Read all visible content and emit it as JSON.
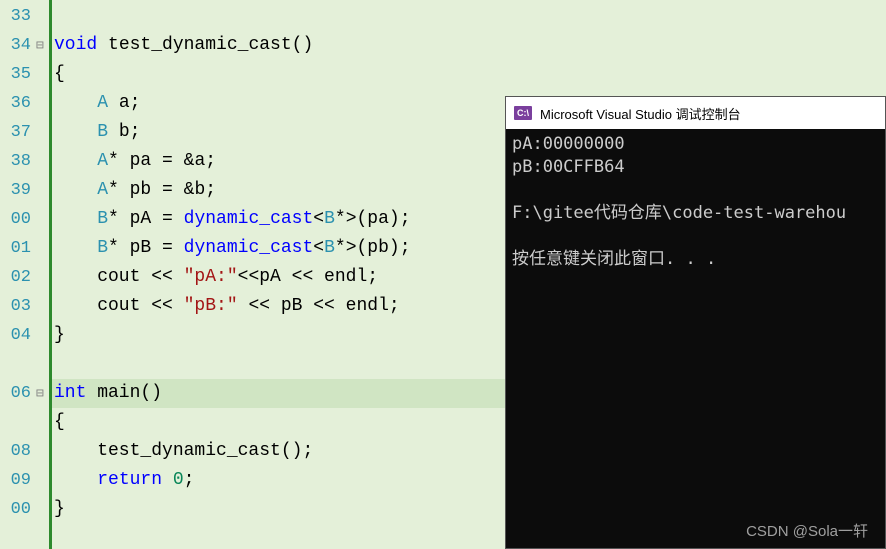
{
  "editor": {
    "lines": [
      {
        "num": "33",
        "fold": "",
        "html": ""
      },
      {
        "num": "34",
        "fold": "⊟",
        "html": "<span class='kw'>void</span> test_dynamic_cast()"
      },
      {
        "num": "35",
        "fold": "",
        "html": "{"
      },
      {
        "num": "36",
        "fold": "",
        "html": "    <span class='typ'>A</span> a;"
      },
      {
        "num": "37",
        "fold": "",
        "html": "    <span class='typ'>B</span> b;"
      },
      {
        "num": "38",
        "fold": "",
        "html": "    <span class='typ'>A</span>* pa = &amp;a;"
      },
      {
        "num": "39",
        "fold": "",
        "html": "    <span class='typ'>A</span>* pb = &amp;b;"
      },
      {
        "num": "00",
        "fold": "",
        "html": "    <span class='typ'>B</span>* pA = <span class='kw'>dynamic_cast</span>&lt;<span class='typ'>B</span>*&gt;(pa);"
      },
      {
        "num": "01",
        "fold": "",
        "html": "    <span class='typ'>B</span>* pB = <span class='kw'>dynamic_cast</span>&lt;<span class='typ'>B</span>*&gt;(pb);"
      },
      {
        "num": "02",
        "fold": "",
        "html": "    cout &lt;&lt; <span class='str'>\"pA:\"</span>&lt;&lt;pA &lt;&lt; endl;"
      },
      {
        "num": "03",
        "fold": "",
        "html": "    cout &lt;&lt; <span class='str'>\"pB:\"</span> &lt;&lt; pB &lt;&lt; endl;"
      },
      {
        "num": "04",
        "fold": "",
        "html": "}"
      },
      {
        "num": "",
        "fold": "",
        "html": ""
      },
      {
        "num": "06",
        "fold": "⊟",
        "html": "<span class='kw'>int</span> main()",
        "hl": true
      },
      {
        "num": "",
        "fold": "",
        "html": "{"
      },
      {
        "num": "08",
        "fold": "",
        "html": "    test_dynamic_cast();"
      },
      {
        "num": "09",
        "fold": "",
        "html": "    <span class='kw'>return</span> <span class='num'>0</span>;"
      },
      {
        "num": "00",
        "fold": "",
        "html": "}"
      }
    ]
  },
  "console": {
    "icon_text": "C:\\",
    "title": "Microsoft Visual Studio 调试控制台",
    "output": "pA:00000000\npB:00CFFB64\n\nF:\\gitee代码仓库\\code-test-warehou\n\n按任意键关闭此窗口. . ."
  },
  "watermark": "CSDN @Sola一轩"
}
